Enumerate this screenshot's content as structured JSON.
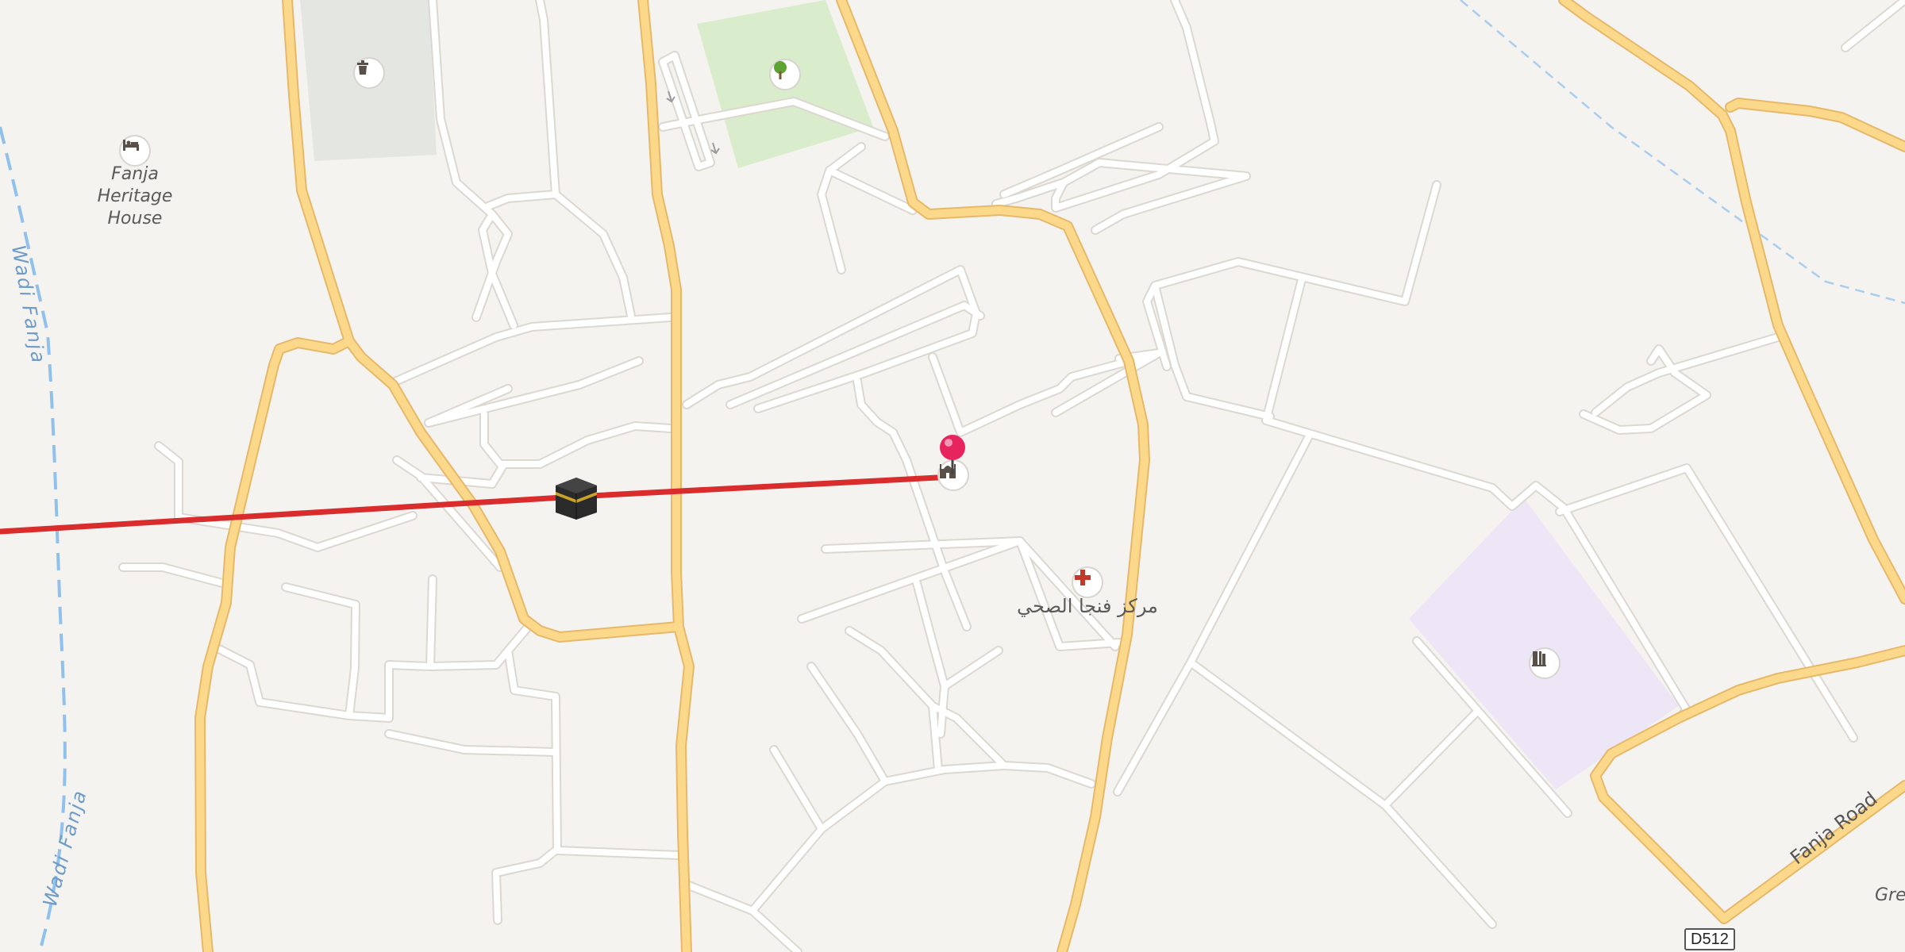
{
  "map": {
    "labels": {
      "heritage_house": "Fanja Heritage House",
      "wadi_fanja_1": "Wadi Fanja",
      "wadi_fanja_2": "Wadi Fanja",
      "health_center": "مركز فنجا الصحي",
      "fanja_road": "Fanja Road",
      "partial_label": "Gre",
      "road_shield": "D512"
    },
    "icons": {
      "heritage_house": "bed-icon",
      "upper_left_poi": "waste-bin-icon",
      "park": "tree-icon",
      "mosque": "mosque-icon",
      "kaaba": "kaaba-icon",
      "clinic": "red-cross-icon",
      "school": "school-icon",
      "marker": "location-pin"
    },
    "colors": {
      "background": "#f5f3f0",
      "minor_road": "#ffffff",
      "major_road": "#fcd98a",
      "major_road_casing": "#e6b86a",
      "waterway": "#8fc1ec",
      "route_line": "#d92c2c",
      "marker": "#e8245f",
      "park": "#d9eccb",
      "cemetery": "#e3e6e1",
      "school_area": "#ece6f6"
    }
  }
}
